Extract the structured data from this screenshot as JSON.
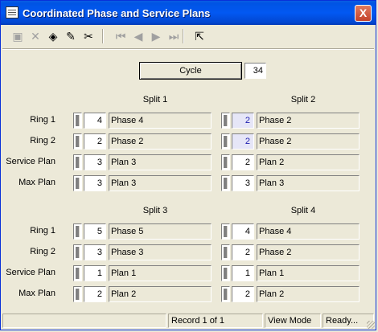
{
  "window": {
    "title": "Coordinated Phase and Service Plans",
    "close_label": "X"
  },
  "toolbar": {
    "buttons": [
      {
        "name": "save-icon",
        "glyph": "▣",
        "enabled": false
      },
      {
        "name": "delete-icon",
        "glyph": "✕",
        "enabled": false
      },
      {
        "name": "stack-icon",
        "glyph": "◈",
        "enabled": true
      },
      {
        "name": "pencil-icon",
        "glyph": "✎",
        "enabled": true
      },
      {
        "name": "scissors-icon",
        "glyph": "✂",
        "enabled": true
      },
      {
        "name": "first-record-icon",
        "glyph": "⏮",
        "enabled": false
      },
      {
        "name": "previous-record-icon",
        "glyph": "◀",
        "enabled": false
      },
      {
        "name": "next-record-icon",
        "glyph": "▶",
        "enabled": false
      },
      {
        "name": "last-record-icon",
        "glyph": "⏭",
        "enabled": false
      },
      {
        "name": "exit-icon",
        "glyph": "⇱",
        "enabled": true
      }
    ]
  },
  "cycle": {
    "label": "Cycle",
    "value": "34"
  },
  "row_labels": [
    "Ring 1",
    "Ring 2",
    "Service Plan",
    "Max Plan"
  ],
  "splits": [
    {
      "title": "Split 1",
      "rows": [
        {
          "num": "4",
          "text": "Phase 4",
          "tinted": false
        },
        {
          "num": "2",
          "text": "Phase 2",
          "tinted": false
        },
        {
          "num": "3",
          "text": "Plan 3",
          "tinted": false
        },
        {
          "num": "3",
          "text": "Plan 3",
          "tinted": false
        }
      ]
    },
    {
      "title": "Split 2",
      "rows": [
        {
          "num": "2",
          "text": "Phase 2",
          "tinted": true
        },
        {
          "num": "2",
          "text": "Phase 2",
          "tinted": true
        },
        {
          "num": "2",
          "text": "Plan 2",
          "tinted": false
        },
        {
          "num": "3",
          "text": "Plan 3",
          "tinted": false
        }
      ]
    },
    {
      "title": "Split 3",
      "rows": [
        {
          "num": "5",
          "text": "Phase 5",
          "tinted": false
        },
        {
          "num": "3",
          "text": "Phase 3",
          "tinted": false
        },
        {
          "num": "1",
          "text": "Plan 1",
          "tinted": false
        },
        {
          "num": "2",
          "text": "Plan 2",
          "tinted": false
        }
      ]
    },
    {
      "title": "Split 4",
      "rows": [
        {
          "num": "4",
          "text": "Phase 4",
          "tinted": false
        },
        {
          "num": "2",
          "text": "Phase 2",
          "tinted": false
        },
        {
          "num": "1",
          "text": "Plan 1",
          "tinted": false
        },
        {
          "num": "2",
          "text": "Plan 2",
          "tinted": false
        }
      ]
    }
  ],
  "status": {
    "record": "Record 1 of 1",
    "mode": "View Mode",
    "state": "Ready..."
  }
}
